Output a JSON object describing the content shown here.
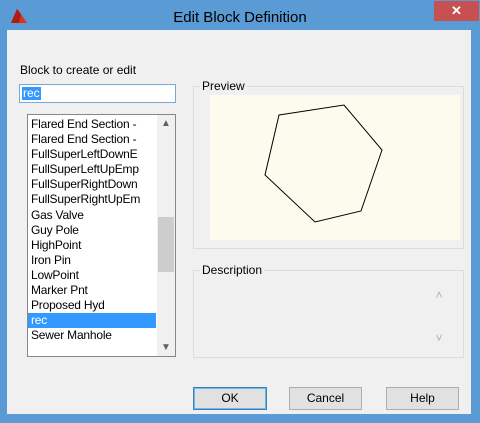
{
  "window": {
    "title": "Edit Block Definition",
    "close_glyph": "✕",
    "app_icon": "autocad-icon"
  },
  "block": {
    "label": "Block to create or edit",
    "name_value": "rec",
    "list": {
      "items": [
        "Flared End Section -",
        "Flared End Section -",
        "FullSuperLeftDownE",
        "FullSuperLeftUpEmp",
        "FullSuperRightDown",
        "FullSuperRightUpEm",
        "Gas Valve",
        "Guy Pole",
        "HighPoint",
        "Iron Pin",
        "LowPoint",
        "Marker Pnt",
        "Proposed Hyd",
        "rec",
        "Sewer Manhole"
      ],
      "selected_index": 13,
      "scroll_up_glyph": "▲",
      "scroll_down_glyph": "▼"
    }
  },
  "preview": {
    "label": "Preview",
    "background_color": "#fcfbed",
    "shape": "hexagon"
  },
  "description": {
    "label": "Description",
    "value": "",
    "scroll_up_glyph": "˄",
    "scroll_down_glyph": "˅"
  },
  "buttons": {
    "ok": "OK",
    "cancel": "Cancel",
    "help": "Help"
  },
  "colors": {
    "titlebar": "#5b9bd5",
    "close": "#c75050",
    "selection": "#3399ff"
  }
}
